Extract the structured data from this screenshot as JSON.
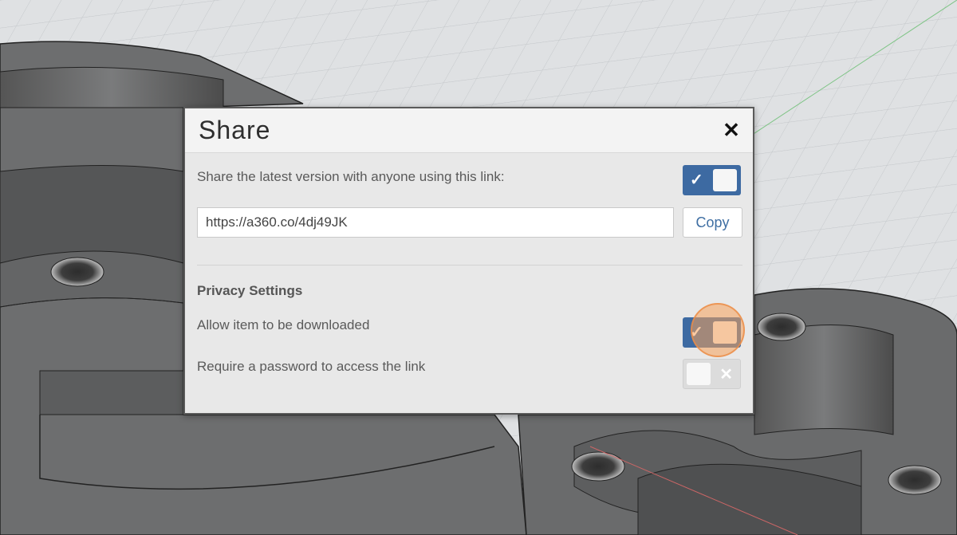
{
  "dialog": {
    "title": "Share",
    "close_icon": "close-icon"
  },
  "share": {
    "label": "Share the latest version with anyone using this link:",
    "link_enabled": true,
    "link_url": "https://a360.co/4dj49JK",
    "copy_label": "Copy"
  },
  "privacy": {
    "title": "Privacy Settings",
    "allow_download": {
      "label": "Allow item to be downloaded",
      "enabled": true
    },
    "require_password": {
      "label": "Require a password to access the link",
      "enabled": false
    }
  },
  "icons": {
    "toggle_on": "checkmark-icon",
    "toggle_off": "x-icon"
  },
  "colors": {
    "accent": "#3d6aa2",
    "link_text": "#3f6fa3",
    "highlight": "#f5a05a"
  }
}
